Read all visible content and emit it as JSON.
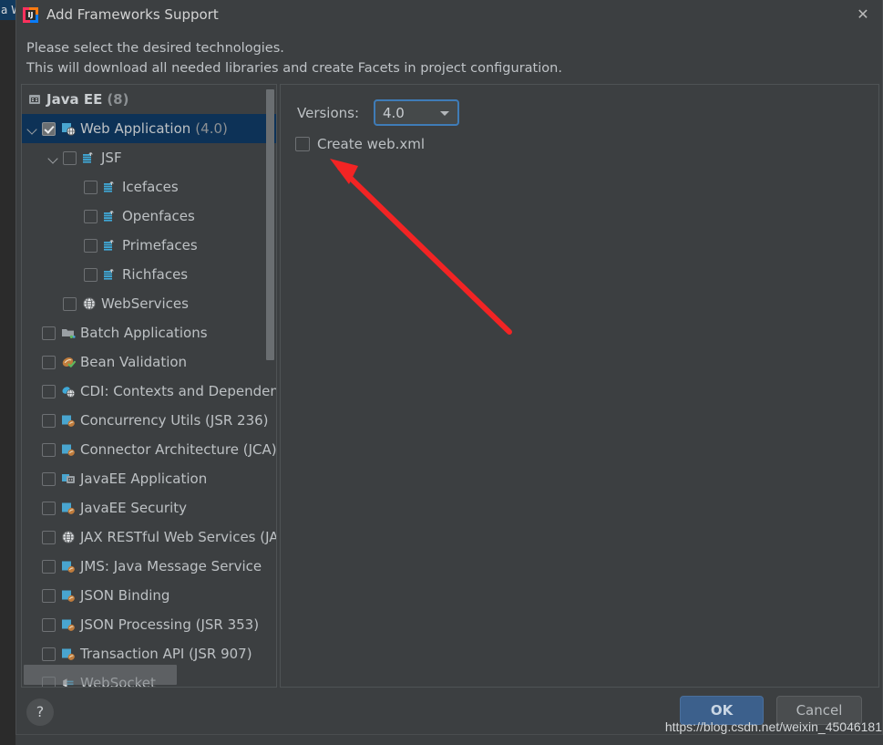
{
  "background_window": {
    "partial_title": "a W"
  },
  "dialog": {
    "title": "Add Frameworks Support",
    "app_icon": "intellij-idea-icon",
    "close_icon": "close-icon",
    "intro_line1": "Please select the desired technologies.",
    "intro_line2": "This will download all needed libraries and create Facets in project configuration."
  },
  "tree": {
    "group": {
      "label": "Java EE",
      "count": "(8)",
      "icon": "javaee-icon"
    },
    "items": [
      {
        "label": "Web Application",
        "suffix": "(4.0)",
        "icon": "web-application-icon",
        "indent": 0,
        "checked": true,
        "selected": true,
        "twisty": "open"
      },
      {
        "label": "JSF",
        "suffix": "",
        "icon": "jsf-icon",
        "indent": 1,
        "checked": false,
        "selected": false,
        "twisty": "open"
      },
      {
        "label": "Icefaces",
        "suffix": "",
        "icon": "jsf-icon",
        "indent": 2,
        "checked": false,
        "selected": false,
        "twisty": "none"
      },
      {
        "label": "Openfaces",
        "suffix": "",
        "icon": "jsf-icon",
        "indent": 2,
        "checked": false,
        "selected": false,
        "twisty": "none"
      },
      {
        "label": "Primefaces",
        "suffix": "",
        "icon": "jsf-icon",
        "indent": 2,
        "checked": false,
        "selected": false,
        "twisty": "none"
      },
      {
        "label": "Richfaces",
        "suffix": "",
        "icon": "jsf-icon",
        "indent": 2,
        "checked": false,
        "selected": false,
        "twisty": "none"
      },
      {
        "label": "WebServices",
        "suffix": "",
        "icon": "globe-icon",
        "indent": 1,
        "checked": false,
        "selected": false,
        "twisty": "none"
      },
      {
        "label": "Batch Applications",
        "suffix": "",
        "icon": "batch-icon",
        "indent": 0,
        "checked": false,
        "selected": false,
        "twisty": "none"
      },
      {
        "label": "Bean Validation",
        "suffix": "",
        "icon": "bean-validation-icon",
        "indent": 0,
        "checked": false,
        "selected": false,
        "twisty": "none"
      },
      {
        "label": "CDI: Contexts and Dependency Injection",
        "suffix": "",
        "icon": "cdi-icon",
        "indent": 0,
        "checked": false,
        "selected": false,
        "twisty": "none"
      },
      {
        "label": "Concurrency Utils (JSR 236)",
        "suffix": "",
        "icon": "javaee-bean-icon",
        "indent": 0,
        "checked": false,
        "selected": false,
        "twisty": "none"
      },
      {
        "label": "Connector Architecture (JCA)",
        "suffix": "",
        "icon": "javaee-bean-icon",
        "indent": 0,
        "checked": false,
        "selected": false,
        "twisty": "none"
      },
      {
        "label": "JavaEE Application",
        "suffix": "",
        "icon": "javaee-app-icon",
        "indent": 0,
        "checked": false,
        "selected": false,
        "twisty": "none"
      },
      {
        "label": "JavaEE Security",
        "suffix": "",
        "icon": "javaee-bean-icon",
        "indent": 0,
        "checked": false,
        "selected": false,
        "twisty": "none"
      },
      {
        "label": "JAX RESTful Web Services (JAX-RS)",
        "suffix": "",
        "icon": "globe-icon",
        "indent": 0,
        "checked": false,
        "selected": false,
        "twisty": "none"
      },
      {
        "label": "JMS: Java Message Service",
        "suffix": "",
        "icon": "javaee-bean-icon",
        "indent": 0,
        "checked": false,
        "selected": false,
        "twisty": "none"
      },
      {
        "label": "JSON Binding",
        "suffix": "",
        "icon": "javaee-bean-icon",
        "indent": 0,
        "checked": false,
        "selected": false,
        "twisty": "none"
      },
      {
        "label": "JSON Processing (JSR 353)",
        "suffix": "",
        "icon": "javaee-bean-icon",
        "indent": 0,
        "checked": false,
        "selected": false,
        "twisty": "none"
      },
      {
        "label": "Transaction API (JSR 907)",
        "suffix": "",
        "icon": "javaee-bean-icon",
        "indent": 0,
        "checked": false,
        "selected": false,
        "twisty": "none"
      },
      {
        "label": "WebSocket",
        "suffix": "",
        "icon": "websocket-icon",
        "indent": 0,
        "checked": false,
        "selected": false,
        "twisty": "none"
      }
    ],
    "vertical_scrollbar": "tree-vertical-scrollbar",
    "horizontal_scrollbar": "tree-horizontal-scrollbar"
  },
  "details": {
    "versions_label": "Versions:",
    "versions_value": "4.0",
    "create_webxml_label": "Create web.xml",
    "create_webxml_checked": false
  },
  "annotation": {
    "type": "red-arrow",
    "color": "#f22424",
    "points_to": "create-webxml-checkbox"
  },
  "footer": {
    "help_label": "?",
    "ok_label": "OK",
    "cancel_label": "Cancel"
  },
  "watermark": {
    "text": "https://blog.csdn.net/weixin_45046181"
  },
  "colors": {
    "dialog_background": "#3c3f41",
    "selection_blue": "#0d3257",
    "accent_blue": "#3f7cb7",
    "ok_button": "#3c608c",
    "text": "#bdc1c4",
    "annotation_red": "#f22424"
  }
}
